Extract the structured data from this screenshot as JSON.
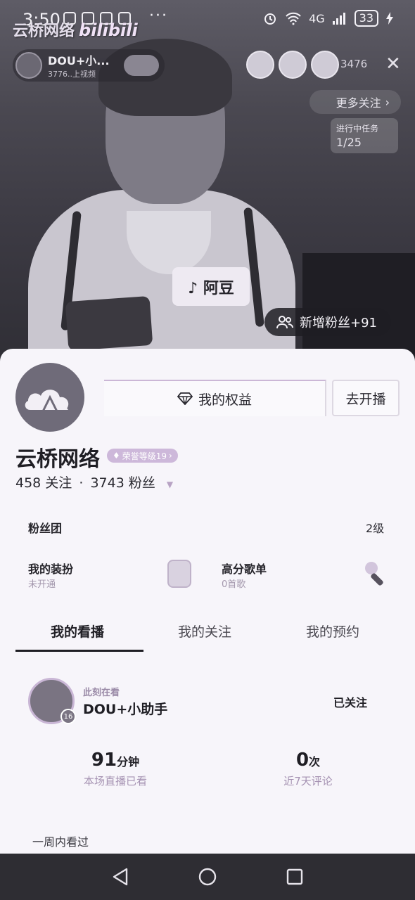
{
  "status_bar": {
    "time": "3:50",
    "dots": "···",
    "network": "4G",
    "battery": "33"
  },
  "watermark": {
    "text": "云桥网络",
    "brand": "bilibili"
  },
  "live": {
    "host_name": "DOU+小...",
    "host_sub": "3776..上视频",
    "viewer_count": "3476",
    "more_follow": "更多关注",
    "task_label": "进行中任务",
    "task_progress": "1/25",
    "sign_text": "♪ 阿豆",
    "new_fans": "新增粉丝+91"
  },
  "profile": {
    "rights_button": "我的权益",
    "go_live_button": "去开播",
    "username": "云桥网络",
    "honor_badge": "荣誉等级19",
    "following": "458 关注",
    "separator": "·",
    "followers": "3743 粉丝"
  },
  "fan_club": {
    "label": "粉丝团",
    "level": "2级"
  },
  "features": {
    "outfit_label": "我的装扮",
    "outfit_sub": "未开通",
    "playlist_label": "高分歌单",
    "playlist_sub": "0首歌"
  },
  "tabs": [
    "我的看播",
    "我的关注",
    "我的预约"
  ],
  "watching": {
    "now_label": "此刻在看",
    "name": "DOU+小助手",
    "badge": "16",
    "followed": "已关注"
  },
  "metrics": {
    "watch_minutes": "91",
    "watch_unit": "分钟",
    "watch_caption": "本场直播已看",
    "comments": "0",
    "comments_unit": "次",
    "comments_caption": "近7天评论"
  },
  "history": {
    "week_label": "一周内看过"
  },
  "colors": {
    "accent_lilac": "#cdb8da",
    "caption": "#a592b2",
    "panel_bg": "#f7f5fa",
    "nav_bg": "#2e2d33"
  }
}
